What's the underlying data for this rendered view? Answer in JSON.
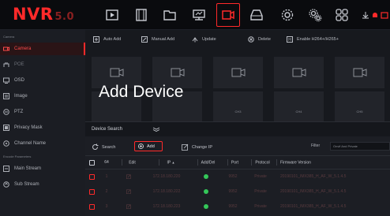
{
  "app": {
    "logo": "NVR",
    "version": "5.0"
  },
  "topbar": {
    "icons": [
      "playback-icon",
      "film-icon",
      "folder-icon",
      "network-icon",
      "camera-icon",
      "storage-icon",
      "settings-gear-icon",
      "system-gear-icon",
      "grid-icon"
    ],
    "active_icon": "camera-icon",
    "accent": "#ff2a2a"
  },
  "sidebar": {
    "section1": "Camera",
    "items": [
      {
        "label": "Camera",
        "icon": "camera-icon",
        "active": true
      },
      {
        "label": "POE",
        "icon": "poe-icon"
      },
      {
        "label": "OSD",
        "icon": "monitor-icon"
      },
      {
        "label": "Image",
        "icon": "image-icon"
      },
      {
        "label": "PTZ",
        "icon": "ptz-icon"
      },
      {
        "label": "Privacy Mask",
        "icon": "mask-icon"
      },
      {
        "label": "Channel Name",
        "icon": "channel-icon"
      }
    ],
    "section2": "Encode Parameters",
    "items2": [
      {
        "label": "Main Stream",
        "icon": "stream-icon"
      },
      {
        "label": "Sub Stream",
        "icon": "substream-icon"
      }
    ]
  },
  "toolbar": {
    "auto_add": "Auto Add",
    "manual_add": "Manual Add",
    "update": "Update",
    "delete": "Delete",
    "enable_h264": "Enable H264+/H265+"
  },
  "tiles": {
    "row1": [
      "",
      "",
      "",
      "",
      ""
    ],
    "row2_captions": [
      "",
      "",
      "CH3",
      "CH4",
      "CH5"
    ]
  },
  "overlay_title": "Add Device",
  "panel": {
    "title": "Device Search",
    "search": "Search",
    "add": "Add",
    "change_ip": "Change IP",
    "filter_label": "Filter",
    "filter_value": "Onvif And Private",
    "columns": [
      "64",
      "Edit",
      "IP",
      "Add/Del",
      "Port",
      "Protocol",
      "Firmware Version"
    ],
    "rows": [
      {
        "num": "1",
        "ip": "172.18.180.220",
        "port": "9952",
        "protocol": "Private",
        "firmware": "20190101_IMX385_H_AF_W_5.1.4.5"
      },
      {
        "num": "2",
        "ip": "172.18.180.222",
        "port": "9952",
        "protocol": "Private",
        "firmware": "20190101_IMX385_H_AF_W_5.1.4.5"
      },
      {
        "num": "3",
        "ip": "172.18.180.223",
        "port": "9952",
        "protocol": "Private",
        "firmware": "20190101_IMX385_H_AF_W_5.1.4.5"
      }
    ]
  }
}
